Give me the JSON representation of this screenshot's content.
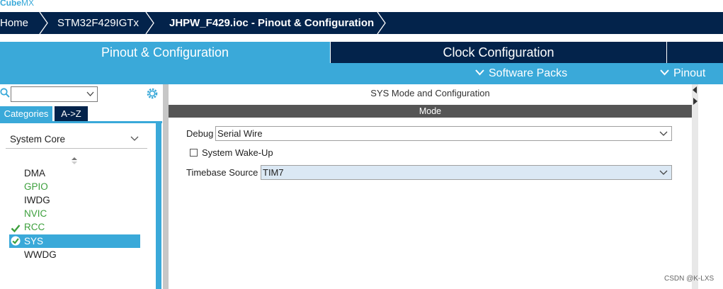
{
  "app": {
    "logo_bold": "Cube",
    "logo_thin": "MX"
  },
  "breadcrumb": {
    "items": [
      "Home",
      "STM32F429IGTx",
      "JHPW_F429.ioc - Pinout & Configuration"
    ]
  },
  "tabs": {
    "active": "Pinout & Configuration",
    "inactive": "Clock Configuration"
  },
  "subbar": {
    "software_packs": "Software Packs",
    "pinout": "Pinout"
  },
  "sidebar": {
    "search": {
      "value": "",
      "placeholder": ""
    },
    "categories_tab": "Categories",
    "az_tab": "A->Z",
    "group": "System Core",
    "items": [
      {
        "label": "DMA",
        "status": "default"
      },
      {
        "label": "GPIO",
        "status": "configured"
      },
      {
        "label": "IWDG",
        "status": "default"
      },
      {
        "label": "NVIC",
        "status": "configured"
      },
      {
        "label": "RCC",
        "status": "checked"
      },
      {
        "label": "SYS",
        "status": "selected"
      },
      {
        "label": "WWDG",
        "status": "default"
      }
    ]
  },
  "main": {
    "title": "SYS Mode and Configuration",
    "mode_header": "Mode",
    "debug_label": "Debug",
    "debug_value": "Serial Wire",
    "wakeup_label": "System Wake-Up",
    "wakeup_checked": false,
    "timebase_label": "Timebase Source",
    "timebase_value": "TIM7"
  },
  "watermark": "CSDN @K-LXS",
  "colors": {
    "navy": "#03234b",
    "accent": "#3aa9d9",
    "green": "#3b9f3b"
  }
}
